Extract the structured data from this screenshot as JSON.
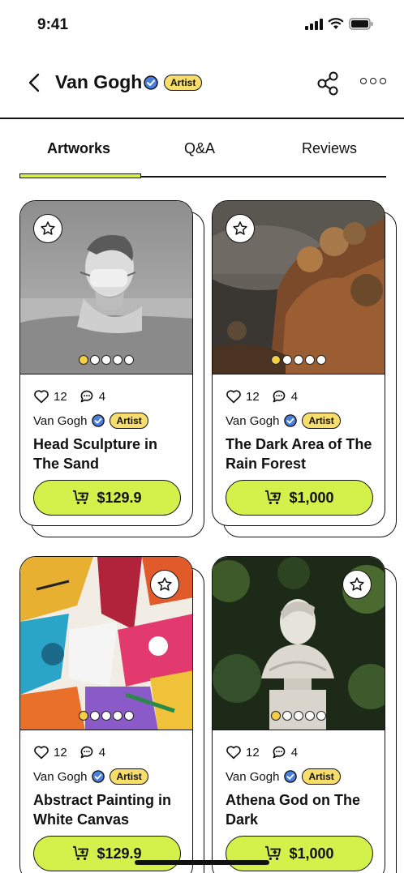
{
  "status": {
    "time": "9:41"
  },
  "header": {
    "artist": "Van Gogh",
    "badge": "Artist"
  },
  "tabs": [
    {
      "label": "Artworks",
      "active": true
    },
    {
      "label": "Q&A",
      "active": false
    },
    {
      "label": "Reviews",
      "active": false
    }
  ],
  "colors": {
    "accent": "#d4f04a",
    "badge": "#f7dd6b",
    "verified": "#4a7fe0"
  },
  "artworks": [
    {
      "title": "Head Sculpture in The Sand",
      "artist": "Van Gogh",
      "badge": "Artist",
      "likes": "12",
      "comments": "4",
      "price": "$129.9",
      "image": "grayscale-bust-sculpture"
    },
    {
      "title": "The Dark Area of The Rain Forest",
      "artist": "Van Gogh",
      "badge": "Artist",
      "likes": "12",
      "comments": "4",
      "price": "$1,000",
      "image": "rainforest-cliff"
    },
    {
      "title": "Abstract Painting in White Canvas",
      "artist": "Van Gogh",
      "badge": "Artist",
      "likes": "12",
      "comments": "4",
      "price": "$129.9",
      "image": "abstract-colorful-paint"
    },
    {
      "title": "Athena God on The Dark",
      "artist": "Van Gogh",
      "badge": "Artist",
      "likes": "12",
      "comments": "4",
      "price": "$1,000",
      "image": "marble-bust-in-foliage"
    }
  ]
}
